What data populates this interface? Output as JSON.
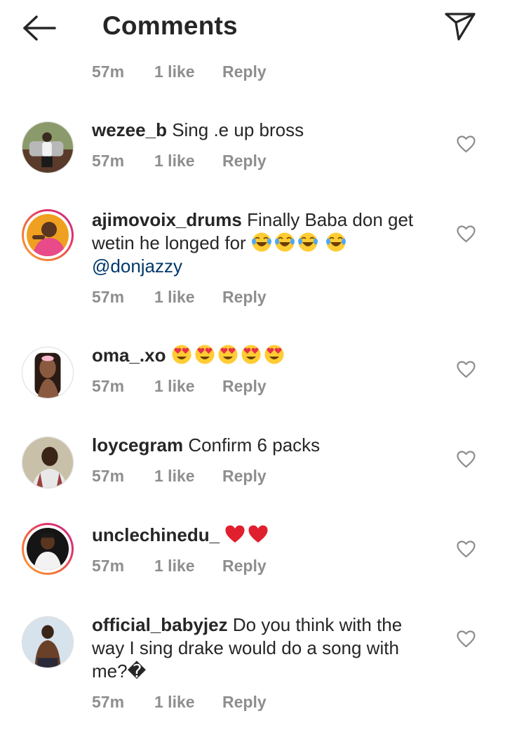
{
  "header": {
    "title": "Comments"
  },
  "top_meta": {
    "time": "57m",
    "likes": "1 like",
    "reply": "Reply"
  },
  "comments": [
    {
      "username": "wezee_b",
      "text": "Sing .e up bross",
      "time": "57m",
      "likes": "1 like",
      "reply": "Reply",
      "story_ring": false
    },
    {
      "username": "ajimovoix_drums",
      "text": "Finally Baba don get wetin he longed for",
      "emojis": [
        "tears-of-joy",
        "tears-of-joy",
        "tears-of-joy",
        "tears-of-joy"
      ],
      "mention": "@donjazzy",
      "time": "57m",
      "likes": "1 like",
      "reply": "Reply",
      "story_ring": true
    },
    {
      "username": "oma_.xo",
      "text": "",
      "emojis": [
        "heart-eyes",
        "heart-eyes",
        "heart-eyes",
        "heart-eyes",
        "heart-eyes"
      ],
      "time": "57m",
      "likes": "1 like",
      "reply": "Reply",
      "story_ring": false
    },
    {
      "username": "loycegram",
      "text": "Confirm 6 packs",
      "time": "57m",
      "likes": "1 like",
      "reply": "Reply",
      "story_ring": false
    },
    {
      "username": "unclechinedu_",
      "text": "",
      "emojis": [
        "red-heart",
        "red-heart"
      ],
      "time": "57m",
      "likes": "1 like",
      "reply": "Reply",
      "story_ring": true
    },
    {
      "username": "official_babyjez",
      "text": "Do you think with the way I sing drake would do a song with me?",
      "trailing_glyph": "�",
      "time": "57m",
      "likes": "1 like",
      "reply": "Reply",
      "story_ring": false
    }
  ],
  "icons": {
    "back": "arrow-left-icon",
    "send": "paper-plane-icon",
    "like": "heart-outline-icon"
  },
  "colors": {
    "meta_gray": "#8e8e8e",
    "mention_blue": "#00376b",
    "ring_start": "#f9a23a",
    "ring_end": "#c13584"
  }
}
